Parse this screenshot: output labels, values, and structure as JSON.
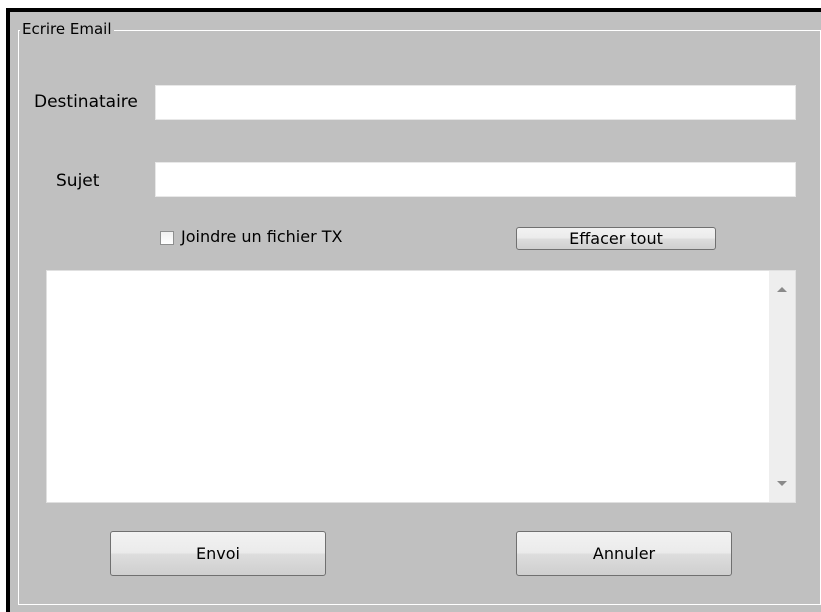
{
  "form": {
    "group_title": "Ecrire Email",
    "recipient_label": "Destinataire",
    "recipient_value": "",
    "subject_label": "Sujet",
    "subject_value": "",
    "attach_label": "Joindre un fichier TX",
    "attach_checked": false,
    "clear_label": "Effacer tout",
    "body_value": "",
    "send_label": "Envoi",
    "cancel_label": "Annuler"
  },
  "icons": {
    "scroll_up": "arrow-up-icon",
    "scroll_down": "arrow-down-icon"
  }
}
